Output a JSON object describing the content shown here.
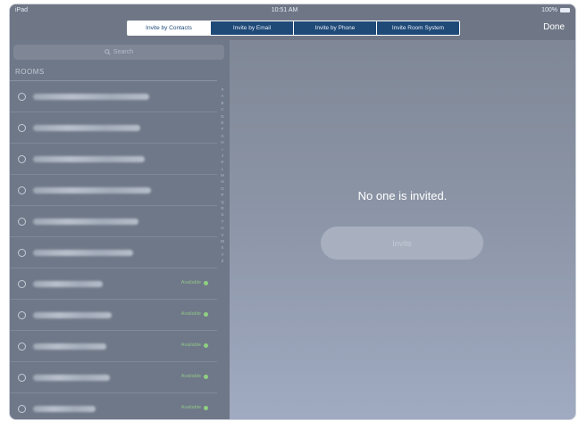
{
  "status_bar": {
    "left": "iPad",
    "time": "10:51 AM",
    "battery": "100%"
  },
  "nav": {
    "tabs": [
      {
        "label": "Invite by Contacts",
        "active": true
      },
      {
        "label": "Invite by Email",
        "active": false
      },
      {
        "label": "Invite by Phone",
        "active": false
      },
      {
        "label": "Invite Room System",
        "active": false
      }
    ],
    "done_label": "Done"
  },
  "left_panel": {
    "search_placeholder": "Search",
    "section_header": "ROOMS",
    "rooms": [
      {
        "available": false
      },
      {
        "available": false
      },
      {
        "available": false
      },
      {
        "available": false
      },
      {
        "available": false
      },
      {
        "available": false
      },
      {
        "available": true,
        "status": "Available"
      },
      {
        "available": true,
        "status": "Available"
      },
      {
        "available": true,
        "status": "Available"
      },
      {
        "available": true,
        "status": "Available"
      },
      {
        "available": true,
        "status": "Available"
      }
    ],
    "index_letters": [
      "#",
      "A",
      "B",
      "C",
      "D",
      "E",
      "F",
      "G",
      "H",
      "I",
      "J",
      "K",
      "L",
      "M",
      "N",
      "O",
      "P",
      "Q",
      "R",
      "S",
      "T",
      "U",
      "V",
      "W",
      "X",
      "Y",
      "Z"
    ]
  },
  "right_panel": {
    "message": "No one is invited.",
    "invite_button": "Invite"
  },
  "colors": {
    "tab_active_bg": "#ffffff",
    "tab_inactive_bg": "#1f4a78",
    "available_green": "#8fd07f"
  }
}
